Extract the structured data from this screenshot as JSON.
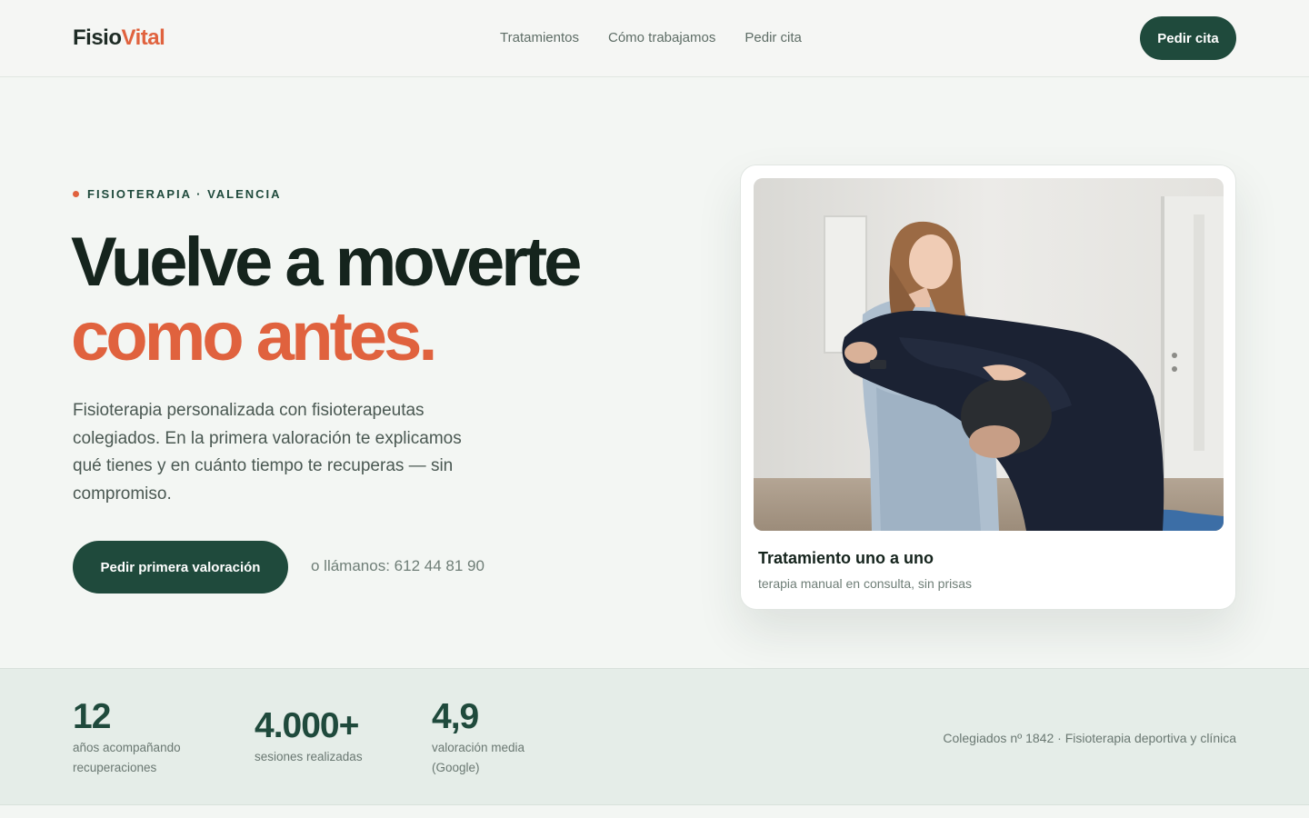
{
  "brand": {
    "part1": "Fisio",
    "part2": "Vital"
  },
  "nav": {
    "links": [
      "Tratamientos",
      "Cómo trabajamos",
      "Pedir cita"
    ],
    "cta": "Pedir cita"
  },
  "hero": {
    "eyebrow": "FISIOTERAPIA · VALENCIA",
    "headline_line1": "Vuelve a moverte",
    "headline_line2": "como antes.",
    "lede": "Fisioterapia personalizada con fisioterapeutas colegiados. En la primera valoración te explicamos qué tienes y en cuánto tiempo te recuperas — sin compromiso.",
    "cta": "Pedir primera valoración",
    "phone": "o llámanos: 612 44 81 90"
  },
  "card": {
    "title": "Tratamiento uno a uno",
    "subtitle": "terapia manual en consulta, sin prisas",
    "photo_alt": "physiotherapist-treating-patient-photo"
  },
  "stats": {
    "items": [
      {
        "num": "12",
        "label_line1": "años acompañando",
        "label_line2": "recuperaciones"
      },
      {
        "num": "4.000+",
        "label_line1": "sesiones realizadas",
        "label_line2": ""
      },
      {
        "num": "4,9",
        "label_line1": "valoración media",
        "label_line2": "(Google)"
      }
    ],
    "note": "Colegiados nº 1842 · Fisioterapia deportiva y clínica"
  },
  "colors": {
    "accent": "#e0623e",
    "brand_green": "#1f4a3c",
    "page_bg": "#f3f6f3",
    "stats_bg": "#e5ede8"
  }
}
